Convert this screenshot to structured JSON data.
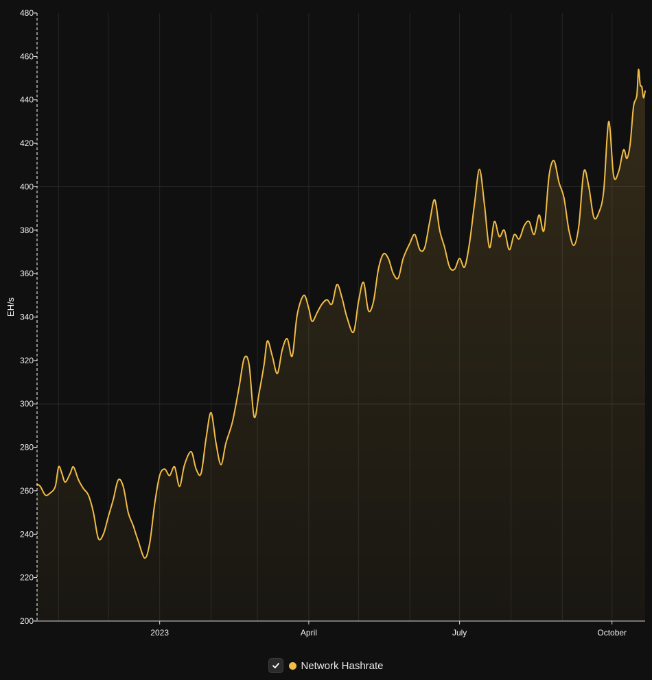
{
  "chart_data": {
    "type": "area",
    "ylabel": "EH/s",
    "ylim": [
      200,
      480
    ],
    "yticks": [
      200,
      220,
      240,
      260,
      280,
      300,
      320,
      340,
      360,
      380,
      400,
      420,
      440,
      460,
      480
    ],
    "x_range": [
      "2022-10-19",
      "2023-10-21"
    ],
    "xticks": [
      {
        "date": "2023-01-01",
        "label": "2023"
      },
      {
        "date": "2023-04-01",
        "label": "April"
      },
      {
        "date": "2023-07-01",
        "label": "July"
      },
      {
        "date": "2023-10-01",
        "label": "October"
      }
    ],
    "grid": true,
    "legend_position": "bottom-center",
    "series": [
      {
        "name": "Network Hashrate",
        "color": "#f2bd47",
        "points": [
          [
            "2022-10-19",
            263
          ],
          [
            "2022-10-21",
            262
          ],
          [
            "2022-10-24",
            258
          ],
          [
            "2022-10-27",
            259
          ],
          [
            "2022-10-30",
            262
          ],
          [
            "2022-11-01",
            271
          ],
          [
            "2022-11-03",
            268
          ],
          [
            "2022-11-05",
            264
          ],
          [
            "2022-11-08",
            268
          ],
          [
            "2022-11-10",
            271
          ],
          [
            "2022-11-13",
            265
          ],
          [
            "2022-11-16",
            261
          ],
          [
            "2022-11-19",
            258
          ],
          [
            "2022-11-22",
            250
          ],
          [
            "2022-11-25",
            238
          ],
          [
            "2022-11-28",
            240
          ],
          [
            "2022-12-01",
            248
          ],
          [
            "2022-12-04",
            256
          ],
          [
            "2022-12-07",
            265
          ],
          [
            "2022-12-10",
            262
          ],
          [
            "2022-12-13",
            250
          ],
          [
            "2022-12-16",
            244
          ],
          [
            "2022-12-19",
            237
          ],
          [
            "2022-12-23",
            229
          ],
          [
            "2022-12-26",
            236
          ],
          [
            "2022-12-29",
            254
          ],
          [
            "2023-01-01",
            267
          ],
          [
            "2023-01-04",
            270
          ],
          [
            "2023-01-07",
            267
          ],
          [
            "2023-01-10",
            271
          ],
          [
            "2023-01-13",
            262
          ],
          [
            "2023-01-16",
            272
          ],
          [
            "2023-01-20",
            278
          ],
          [
            "2023-01-23",
            270
          ],
          [
            "2023-01-26",
            268
          ],
          [
            "2023-01-29",
            284
          ],
          [
            "2023-02-01",
            296
          ],
          [
            "2023-02-04",
            282
          ],
          [
            "2023-02-07",
            272
          ],
          [
            "2023-02-10",
            282
          ],
          [
            "2023-02-14",
            292
          ],
          [
            "2023-02-18",
            308
          ],
          [
            "2023-02-21",
            321
          ],
          [
            "2023-02-24",
            318
          ],
          [
            "2023-02-27",
            294
          ],
          [
            "2023-03-02",
            305
          ],
          [
            "2023-03-05",
            318
          ],
          [
            "2023-03-07",
            329
          ],
          [
            "2023-03-10",
            322
          ],
          [
            "2023-03-13",
            314
          ],
          [
            "2023-03-16",
            325
          ],
          [
            "2023-03-19",
            330
          ],
          [
            "2023-03-22",
            322
          ],
          [
            "2023-03-25",
            341
          ],
          [
            "2023-03-29",
            350
          ],
          [
            "2023-04-01",
            344
          ],
          [
            "2023-04-03",
            338
          ],
          [
            "2023-04-06",
            342
          ],
          [
            "2023-04-09",
            346
          ],
          [
            "2023-04-12",
            348
          ],
          [
            "2023-04-15",
            346
          ],
          [
            "2023-04-18",
            355
          ],
          [
            "2023-04-21",
            349
          ],
          [
            "2023-04-24",
            340
          ],
          [
            "2023-04-28",
            333
          ],
          [
            "2023-05-01",
            347
          ],
          [
            "2023-05-04",
            356
          ],
          [
            "2023-05-07",
            343
          ],
          [
            "2023-05-10",
            347
          ],
          [
            "2023-05-13",
            362
          ],
          [
            "2023-05-16",
            369
          ],
          [
            "2023-05-19",
            367
          ],
          [
            "2023-05-22",
            360
          ],
          [
            "2023-05-25",
            358
          ],
          [
            "2023-05-28",
            367
          ],
          [
            "2023-06-01",
            374
          ],
          [
            "2023-06-04",
            378
          ],
          [
            "2023-06-07",
            371
          ],
          [
            "2023-06-10",
            372
          ],
          [
            "2023-06-13",
            384
          ],
          [
            "2023-06-16",
            394
          ],
          [
            "2023-06-19",
            380
          ],
          [
            "2023-06-22",
            372
          ],
          [
            "2023-06-25",
            363
          ],
          [
            "2023-06-28",
            362
          ],
          [
            "2023-07-01",
            367
          ],
          [
            "2023-07-04",
            363
          ],
          [
            "2023-07-07",
            374
          ],
          [
            "2023-07-10",
            392
          ],
          [
            "2023-07-13",
            408
          ],
          [
            "2023-07-16",
            392
          ],
          [
            "2023-07-19",
            372
          ],
          [
            "2023-07-22",
            384
          ],
          [
            "2023-07-25",
            377
          ],
          [
            "2023-07-28",
            380
          ],
          [
            "2023-07-31",
            371
          ],
          [
            "2023-08-03",
            378
          ],
          [
            "2023-08-06",
            376
          ],
          [
            "2023-08-09",
            382
          ],
          [
            "2023-08-12",
            384
          ],
          [
            "2023-08-15",
            378
          ],
          [
            "2023-08-18",
            387
          ],
          [
            "2023-08-21",
            380
          ],
          [
            "2023-08-24",
            405
          ],
          [
            "2023-08-27",
            412
          ],
          [
            "2023-08-30",
            402
          ],
          [
            "2023-09-02",
            395
          ],
          [
            "2023-09-05",
            380
          ],
          [
            "2023-09-08",
            373
          ],
          [
            "2023-09-11",
            382
          ],
          [
            "2023-09-14",
            407
          ],
          [
            "2023-09-17",
            400
          ],
          [
            "2023-09-20",
            386
          ],
          [
            "2023-09-23",
            388
          ],
          [
            "2023-09-26",
            398
          ],
          [
            "2023-09-29",
            430
          ],
          [
            "2023-10-02",
            405
          ],
          [
            "2023-10-05",
            407
          ],
          [
            "2023-10-08",
            417
          ],
          [
            "2023-10-10",
            413
          ],
          [
            "2023-10-12",
            420
          ],
          [
            "2023-10-14",
            437
          ],
          [
            "2023-10-16",
            442
          ],
          [
            "2023-10-17",
            454
          ],
          [
            "2023-10-18",
            447
          ],
          [
            "2023-10-19",
            446
          ],
          [
            "2023-10-20",
            441
          ],
          [
            "2023-10-21",
            444
          ]
        ]
      }
    ]
  },
  "legend": {
    "label": "Network Hashrate",
    "checked": true,
    "check_icon": "check-icon",
    "dot_color": "#f2bd47"
  },
  "colors": {
    "background": "#101010",
    "line": "#f2bd47",
    "grid": "#2a2a2a"
  }
}
